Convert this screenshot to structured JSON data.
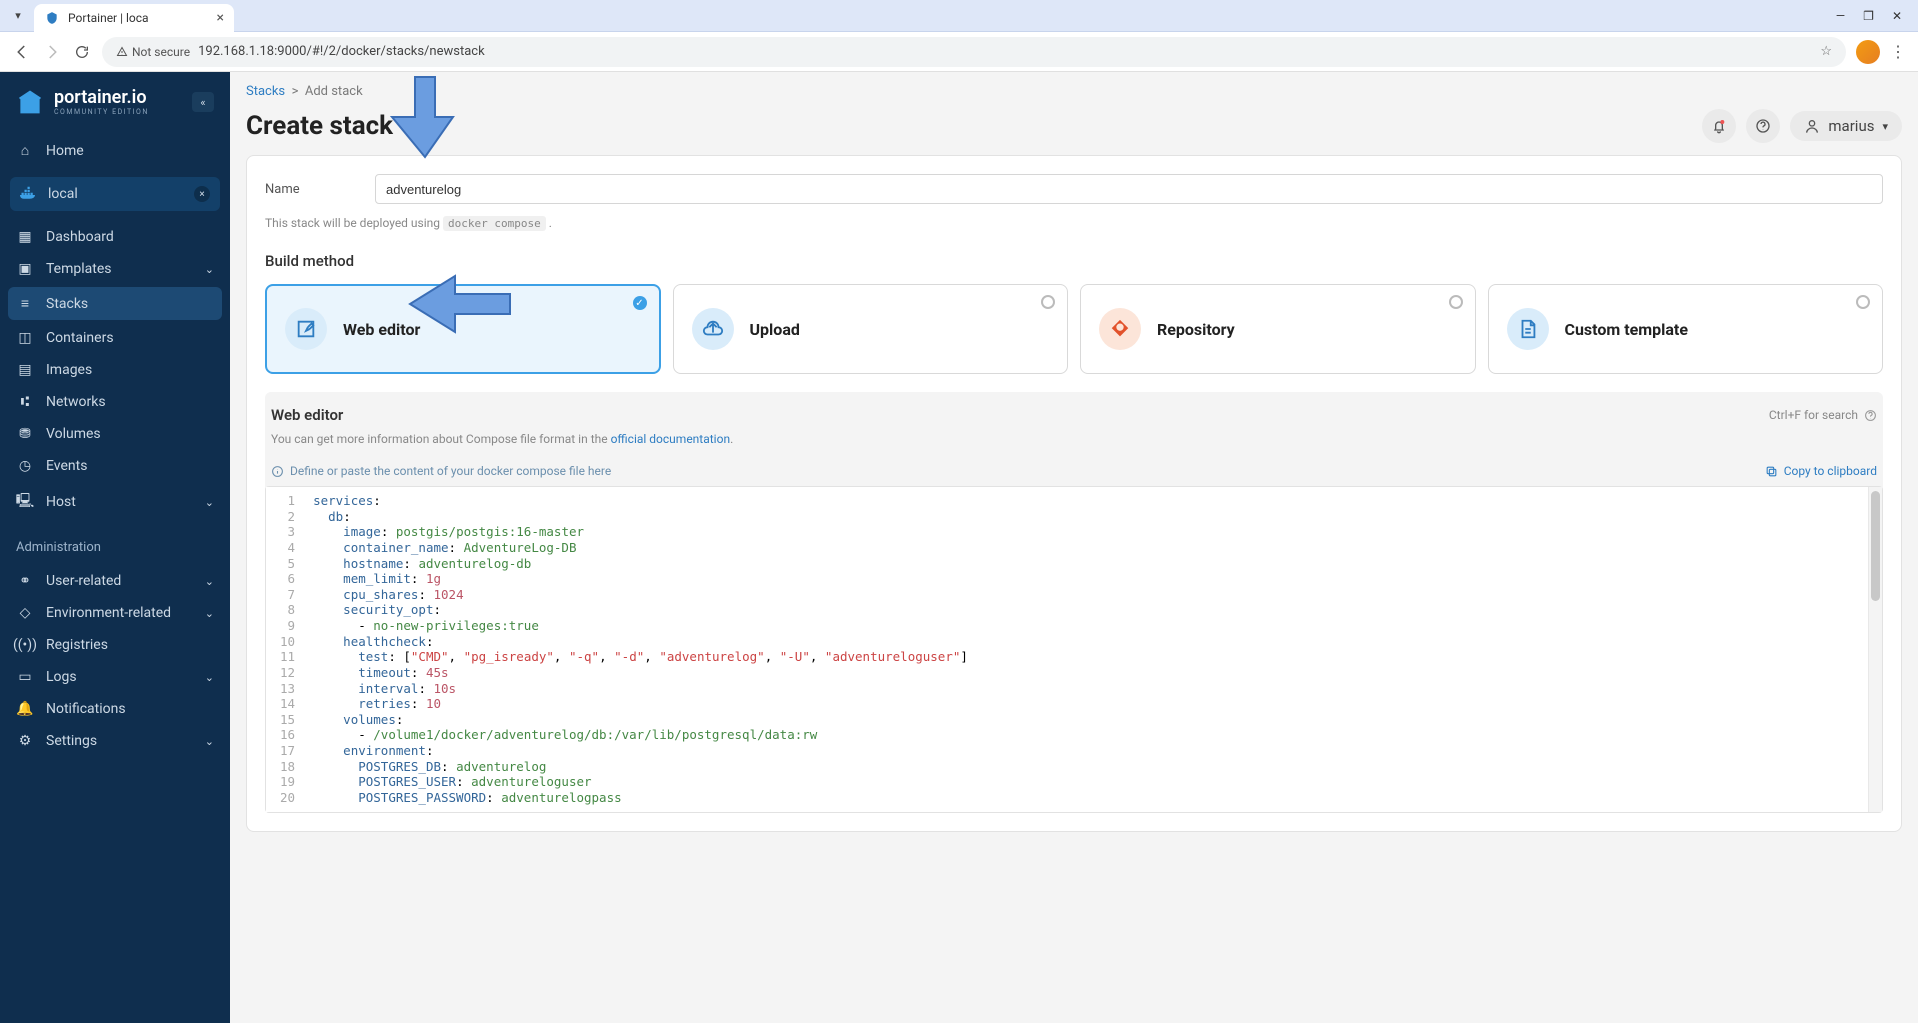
{
  "browser": {
    "tab_title": "Portainer | loca",
    "not_secure": "Not secure",
    "url": "192.168.1.18:9000/#!/2/docker/stacks/newstack"
  },
  "sidebar": {
    "logo_main": "portainer.io",
    "logo_sub": "COMMUNITY EDITION",
    "home": "Home",
    "env_name": "local",
    "items": [
      "Dashboard",
      "Templates",
      "Stacks",
      "Containers",
      "Images",
      "Networks",
      "Volumes",
      "Events",
      "Host"
    ],
    "admin_label": "Administration",
    "admin_items": [
      "User-related",
      "Environment-related",
      "Registries",
      "Logs",
      "Notifications",
      "Settings"
    ]
  },
  "breadcrumb": {
    "parent": "Stacks",
    "current": "Add stack"
  },
  "page": {
    "title": "Create stack",
    "username": "marius"
  },
  "form": {
    "name_label": "Name",
    "name_value": "adventurelog",
    "deploy_note_prefix": "This stack will be deployed using ",
    "deploy_note_code": "docker compose",
    "build_method_title": "Build method",
    "methods": [
      "Web editor",
      "Upload",
      "Repository",
      "Custom template"
    ]
  },
  "editor": {
    "header": "Web editor",
    "search_hint": "Ctrl+F for search",
    "desc_prefix": "You can get more information about Compose file format in the ",
    "desc_link": "official documentation",
    "placeholder_hint": "Define or paste the content of your docker compose file here",
    "copy_label": "Copy to clipboard"
  },
  "code": {
    "lines": [
      {
        "n": 1,
        "raw": "services:"
      },
      {
        "n": 2,
        "raw": "  db:"
      },
      {
        "n": 3,
        "raw": "    image: postgis/postgis:16-master"
      },
      {
        "n": 4,
        "raw": "    container_name: AdventureLog-DB"
      },
      {
        "n": 5,
        "raw": "    hostname: adventurelog-db"
      },
      {
        "n": 6,
        "raw": "    mem_limit: 1g"
      },
      {
        "n": 7,
        "raw": "    cpu_shares: 1024"
      },
      {
        "n": 8,
        "raw": "    security_opt:"
      },
      {
        "n": 9,
        "raw": "      - no-new-privileges:true"
      },
      {
        "n": 10,
        "raw": "    healthcheck:"
      },
      {
        "n": 11,
        "raw": "      test: [\"CMD\", \"pg_isready\", \"-q\", \"-d\", \"adventurelog\", \"-U\", \"adventureloguser\"]"
      },
      {
        "n": 12,
        "raw": "      timeout: 45s"
      },
      {
        "n": 13,
        "raw": "      interval: 10s"
      },
      {
        "n": 14,
        "raw": "      retries: 10"
      },
      {
        "n": 15,
        "raw": "    volumes:"
      },
      {
        "n": 16,
        "raw": "      - /volume1/docker/adventurelog/db:/var/lib/postgresql/data:rw"
      },
      {
        "n": 17,
        "raw": "    environment:"
      },
      {
        "n": 18,
        "raw": "      POSTGRES_DB: adventurelog"
      },
      {
        "n": 19,
        "raw": "      POSTGRES_USER: adventureloguser"
      },
      {
        "n": 20,
        "raw": "      POSTGRES_PASSWORD: adventurelogpass"
      }
    ]
  },
  "chart_data": null
}
